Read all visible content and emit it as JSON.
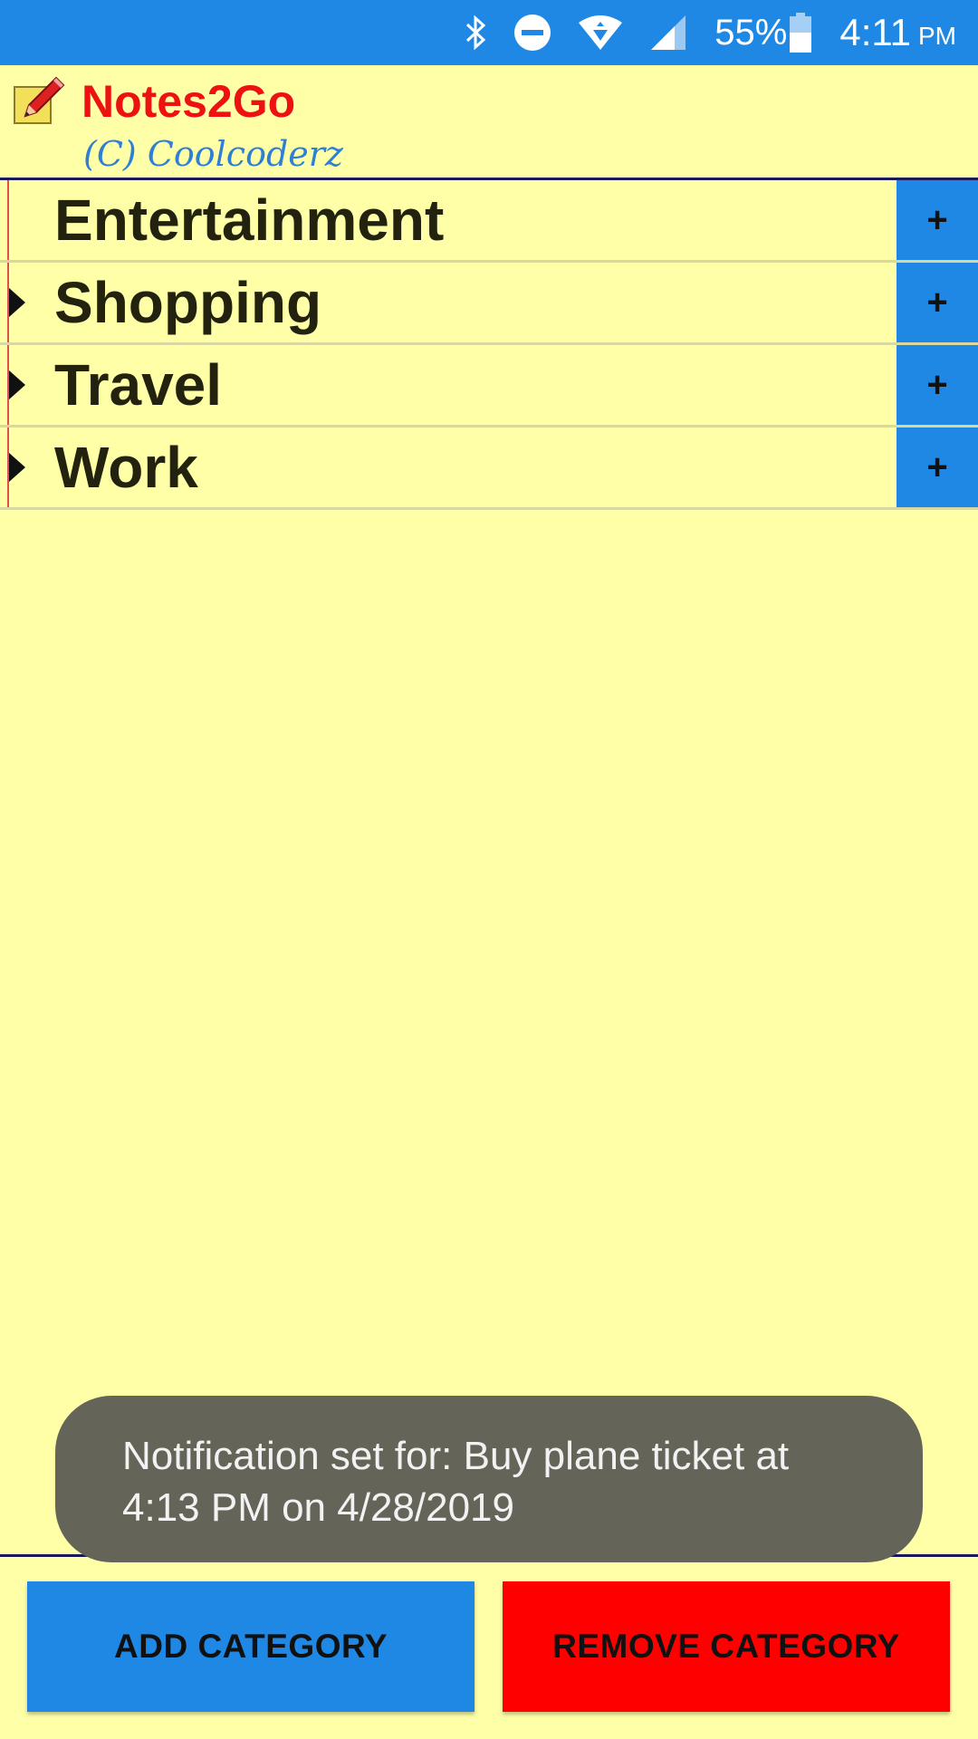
{
  "status_bar": {
    "battery_percent": "55%",
    "time": "4:11",
    "ampm": "PM",
    "icons": [
      "bluetooth-icon",
      "do-not-disturb-icon",
      "wifi-icon",
      "cellular-signal-icon",
      "battery-icon"
    ]
  },
  "header": {
    "title": "Notes2Go",
    "copyright": "(C) Coolcoderz",
    "icon": "notepad-pencil-icon"
  },
  "categories": [
    {
      "label": "Entertainment",
      "expandable": false,
      "add_label": "+"
    },
    {
      "label": "Shopping",
      "expandable": true,
      "add_label": "+"
    },
    {
      "label": "Travel",
      "expandable": true,
      "add_label": "+"
    },
    {
      "label": "Work",
      "expandable": true,
      "add_label": "+"
    }
  ],
  "toast": {
    "line1": "Notification set for: Buy plane ticket at",
    "line2": "4:13 PM on 4/28/2019"
  },
  "buttons": {
    "add_category": "ADD CATEGORY",
    "remove_category": "REMOVE CATEGORY"
  },
  "colors": {
    "background": "#ffffa8",
    "accent_blue": "#1f88e5",
    "danger_red": "#ff0000",
    "title_red": "#ee1111"
  }
}
